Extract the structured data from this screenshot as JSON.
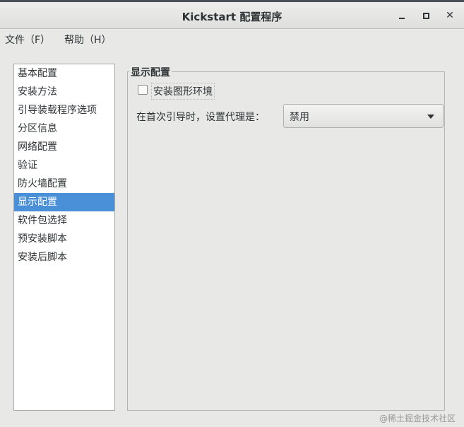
{
  "window": {
    "title": "Kickstart 配置程序"
  },
  "menubar": {
    "file": "文件（F）",
    "help": "帮助（H）"
  },
  "sidebar": {
    "items": [
      {
        "label": "基本配置"
      },
      {
        "label": "安装方法"
      },
      {
        "label": "引导装载程序选项"
      },
      {
        "label": "分区信息"
      },
      {
        "label": "网络配置"
      },
      {
        "label": "验证"
      },
      {
        "label": "防火墙配置"
      },
      {
        "label": "显示配置"
      },
      {
        "label": "软件包选择"
      },
      {
        "label": "预安装脚本"
      },
      {
        "label": "安装后脚本"
      }
    ],
    "selected": "显示配置"
  },
  "display_config": {
    "section_title": "显示配置",
    "install_gui_label": "安装图形环境",
    "install_gui_checked": false,
    "first_boot_label": "在首次引导时，设置代理是：",
    "first_boot_value": "禁用"
  },
  "watermark": "@稀土掘金技术社区",
  "colors": {
    "selection": "#4a90d9",
    "background": "#e8e8e7"
  }
}
